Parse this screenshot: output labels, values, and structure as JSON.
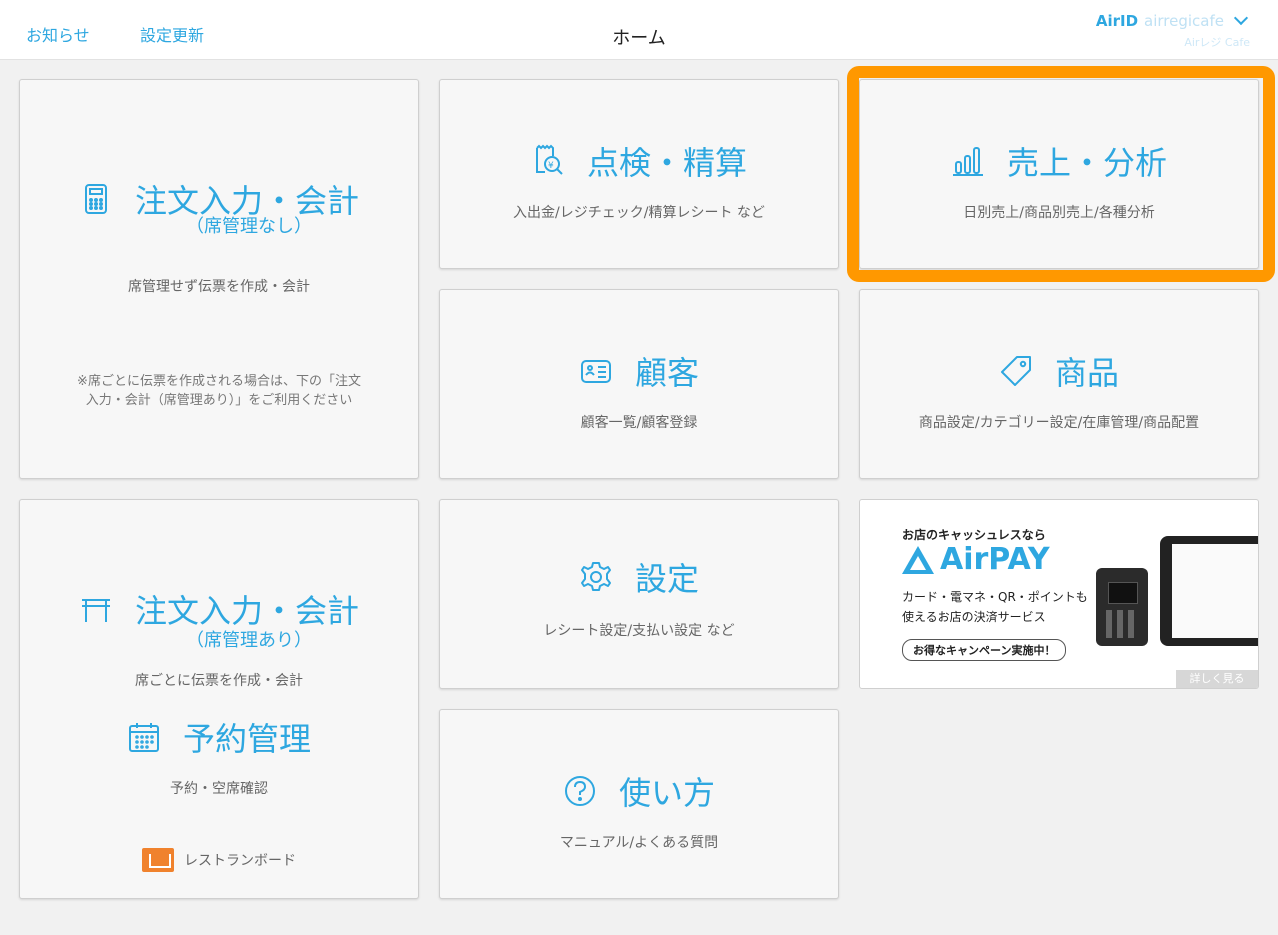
{
  "header": {
    "notice": "お知らせ",
    "settings_update": "設定更新",
    "title": "ホーム",
    "airid_label": "AirID",
    "airid_user": "airregicafe",
    "shop_name": "Airレジ Cafe"
  },
  "tiles": {
    "order_no_seat": {
      "title": "注文入力・会計",
      "subtitle": "（席管理なし）",
      "desc": "席管理せず伝票を作成・会計",
      "note_line1": "※席ごとに伝票を作成される場合は、下の「注文",
      "note_line2": "入力・会計（席管理あり）」をご利用ください"
    },
    "inspection": {
      "title": "点検・精算",
      "desc": "入出金/レジチェック/精算レシート など"
    },
    "sales": {
      "title": "売上・分析",
      "desc": "日別売上/商品別売上/各種分析"
    },
    "customer": {
      "title": "顧客",
      "desc": "顧客一覧/顧客登録"
    },
    "product": {
      "title": "商品",
      "desc": "商品設定/カテゴリー設定/在庫管理/商品配置"
    },
    "order_seat": {
      "title": "注文入力・会計",
      "subtitle": "（席管理あり）",
      "desc": "席ごとに伝票を作成・会計",
      "reserve_title": "予約管理",
      "reserve_desc": "予約・空席確認",
      "restaurant_board": "レストランボード"
    },
    "settings": {
      "title": "設定",
      "desc": "レシート設定/支払い設定 など"
    },
    "howto": {
      "title": "使い方",
      "desc": "マニュアル/よくある質問"
    }
  },
  "banner": {
    "small": "お店のキャッシュレスなら",
    "logo": "AirPAY",
    "line1": "カード・電マネ・QR・ポイントも",
    "line2": "使えるお店の決済サービス",
    "cta": "お得なキャンペーン実施中！",
    "more": "詳しく見る"
  },
  "colors": {
    "accent": "#2ea7e0",
    "highlight": "#ff9800"
  }
}
